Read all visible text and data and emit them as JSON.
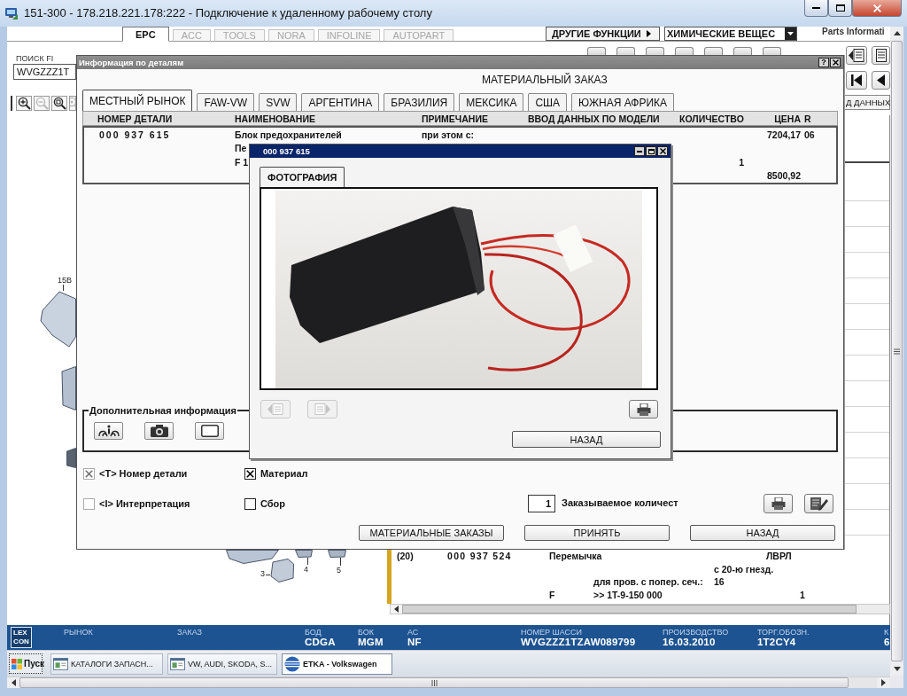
{
  "window": {
    "title": "151-300 - 178.218.221.178:222 - Подключение к удаленному рабочему столу"
  },
  "app": {
    "modules": [
      {
        "label": "EPC",
        "selected": true,
        "disabled": false
      },
      {
        "label": "ACC",
        "selected": false,
        "disabled": true
      },
      {
        "label": "TOOLS",
        "selected": false,
        "disabled": true
      },
      {
        "label": "NORA",
        "selected": false,
        "disabled": true
      },
      {
        "label": "INFOLINE",
        "selected": false,
        "disabled": true
      },
      {
        "label": "AUTOPART",
        "selected": false,
        "disabled": true
      }
    ],
    "menu_button": "ДРУГИЕ ФУНКЦИИ",
    "select": {
      "value": "ХИМИЧЕСКИЕ ВЕЩЕС"
    },
    "corner_text": "Parts Informati",
    "search": {
      "label": "ПОИСК FI",
      "value": "WVGZZZ1T"
    },
    "zoom_tools": [
      {
        "disabled": false
      },
      {
        "disabled": true
      },
      {
        "disabled": false
      },
      {
        "disabled": true
      }
    ],
    "side_button": "Д ДАННЫХ",
    "callouts": [
      "15B",
      "3",
      "4",
      "5"
    ],
    "list_rows": [
      {
        "position": "(20)",
        "part_number": "000 937 524",
        "name": "Перемычка",
        "remark": "ЛВРЛ"
      },
      {
        "value": "с 20-ю гнезд."
      },
      {
        "note": "для пров. с попер. сеч.:",
        "value": "16"
      },
      {
        "flag": "F",
        "note": ">> 1T-9-150 000",
        "quantity": "1"
      }
    ]
  },
  "dialog": {
    "title": "Информация по деталям",
    "help_button": "?",
    "heading": "МАТЕРИАЛЬНЫЙ ЗАКАЗ",
    "tabs": [
      {
        "label": "МЕСТНЫЙ РЫНОК",
        "selected": true
      },
      {
        "label": "FAW-VW",
        "selected": false
      },
      {
        "label": "SVW",
        "selected": false
      },
      {
        "label": "АРГЕНТИНА",
        "selected": false
      },
      {
        "label": "БРАЗИЛИЯ",
        "selected": false
      },
      {
        "label": "МЕКСИКА",
        "selected": false
      },
      {
        "label": "США",
        "selected": false
      },
      {
        "label": "ЮЖНАЯ АФРИКА",
        "selected": false
      }
    ],
    "table": {
      "columns": [
        "НОМЕР ДЕТАЛИ",
        "НАИМЕНОВАНИЕ",
        "ПРИМЕЧАНИЕ",
        "ВВОД ДАННЫХ ПО МОДЕЛИ",
        "КОЛИЧЕСТВО",
        "ЦЕНА",
        "R"
      ],
      "rows": [
        {
          "part_number": "000 937 615",
          "name": "Блок предохранителей",
          "note": "при этом с:",
          "price": "7204,17",
          "r": "06"
        },
        {
          "name": "Пе"
        },
        {
          "name": "F 1",
          "quantity": "1"
        },
        {
          "price": "8500,92"
        }
      ]
    },
    "extra_info": {
      "title": "Дополнительная информация"
    },
    "options": [
      {
        "label": "<T> Номер детали",
        "checked": true,
        "disabled": true
      },
      {
        "label": "Материал",
        "checked": true,
        "disabled": false
      },
      {
        "label": "<I> Интерпретация",
        "checked": false,
        "disabled": true
      },
      {
        "label": "Сбор",
        "checked": false,
        "disabled": false
      }
    ],
    "quantity": {
      "value": "1",
      "label": "Заказываемое количест"
    },
    "buttons": [
      "МАТЕРИАЛЬНЫЕ ЗАКАЗЫ",
      "ПРИНЯТЬ",
      "НАЗАД"
    ]
  },
  "photo_window": {
    "title": "000 937 615",
    "tabs": [
      {
        "label": "ФОТОГРАФИЯ",
        "selected": true
      }
    ],
    "nav_buttons": [
      {
        "disabled": true
      },
      {
        "disabled": true
      }
    ],
    "button": "НАЗАД"
  },
  "status_bar": {
    "logo": [
      "LEX",
      "CON"
    ],
    "fields": [
      {
        "label": "РЫНОК"
      },
      {
        "label": "ЗАКАЗ"
      },
      {
        "label": "БОД",
        "value": "CDGA"
      },
      {
        "label": "БОК",
        "value": "MGM"
      },
      {
        "label": "АС",
        "value": "NF"
      },
      {
        "label": "НОМЕР ШАССИ",
        "value": "WVGZZZ1TZAW089799"
      },
      {
        "label": "ПРОИЗВОДСТВО",
        "value": "16.03.2010"
      },
      {
        "label": "ТОРГ.ОБОЗН.",
        "value": "1T2CY4"
      },
      {
        "label": "К",
        "value": "6"
      }
    ]
  },
  "taskbar": {
    "start": "Пуск",
    "tasks": [
      {
        "label": "КАТАЛОГИ ЗАПАСН...",
        "selected": false,
        "kind": "document"
      },
      {
        "label": "VW, AUDI, SKODA, S...",
        "selected": false,
        "kind": "document"
      },
      {
        "label": "ETKA - Volkswagen",
        "selected": true,
        "kind": "globe"
      }
    ]
  }
}
